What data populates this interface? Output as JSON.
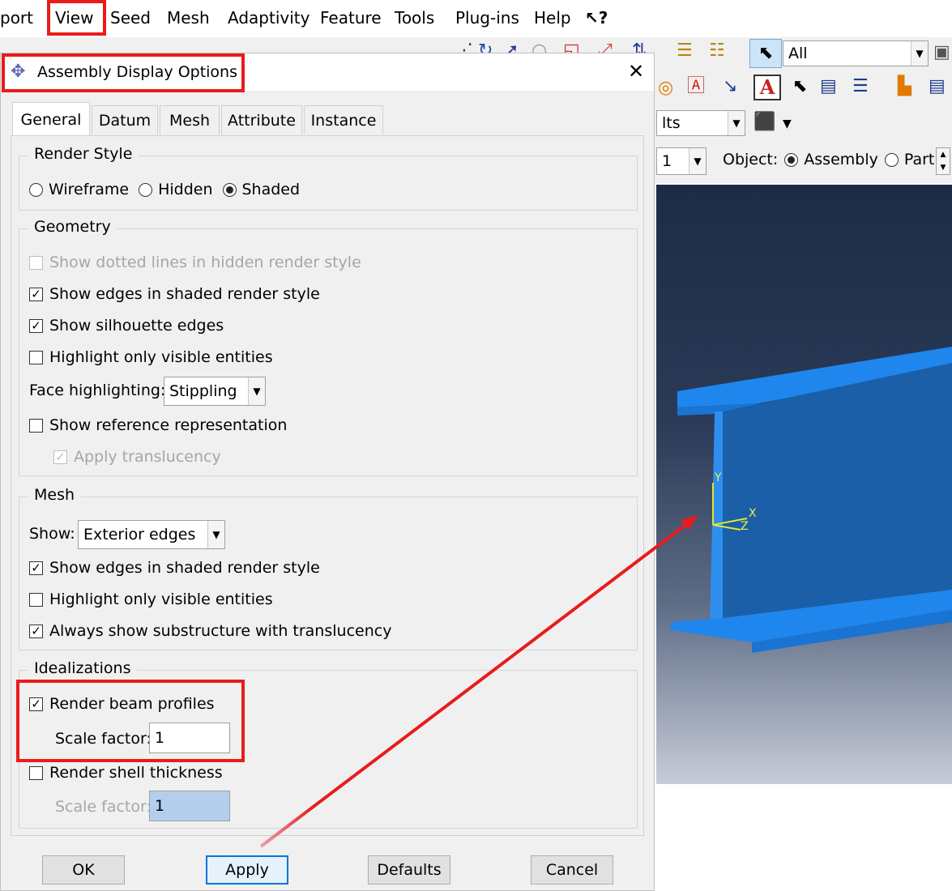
{
  "menu": {
    "items": [
      "port",
      "View",
      "Seed",
      "Mesh",
      "Adaptivity",
      "Feature",
      "Tools",
      "Plug-ins",
      "Help",
      "↖?"
    ]
  },
  "toolbar": {
    "selection_filter": "All",
    "results_combo": "lts",
    "step_combo": "1",
    "object_label": "Object:",
    "assembly_label": "Assembly",
    "part_label": "Part:"
  },
  "viewport": {
    "triad_y": "Y",
    "triad_x": "X",
    "triad_z": "Z",
    "beam_color": "#1e82e8"
  },
  "dialog": {
    "title": "Assembly Display Options",
    "close_glyph": "✕",
    "tabs": [
      "General",
      "Datum",
      "Mesh",
      "Attribute",
      "Instance"
    ],
    "render_style": {
      "title": "Render Style",
      "options": [
        "Wireframe",
        "Hidden",
        "Shaded"
      ],
      "selected": "Shaded"
    },
    "geometry": {
      "title": "Geometry",
      "dotted_lines": "Show dotted lines in hidden render style",
      "edges_shaded": "Show edges in shaded render style",
      "silhouette": "Show silhouette edges",
      "highlight_visible": "Highlight only visible entities",
      "face_highlighting_label": "Face highlighting:",
      "face_highlighting_value": "Stippling",
      "reference_rep": "Show reference representation",
      "translucency": "Apply translucency"
    },
    "mesh": {
      "title": "Mesh",
      "show_label": "Show:",
      "show_value": "Exterior edges",
      "edges_shaded": "Show edges in shaded render style",
      "highlight_visible": "Highlight only visible entities",
      "substructure": "Always show substructure with translucency"
    },
    "idealizations": {
      "title": "Idealizations",
      "beam_profiles": "Render beam profiles",
      "beam_scale_label": "Scale factor:",
      "beam_scale_value": "1",
      "shell_thickness": "Render shell thickness",
      "shell_scale_label": "Scale factor:",
      "shell_scale_value": "1"
    },
    "buttons": {
      "ok": "OK",
      "apply": "Apply",
      "defaults": "Defaults",
      "cancel": "Cancel"
    }
  },
  "colors": {
    "highlight_red": "#ea1b1b",
    "dialog_bg": "#f0f0f0"
  }
}
